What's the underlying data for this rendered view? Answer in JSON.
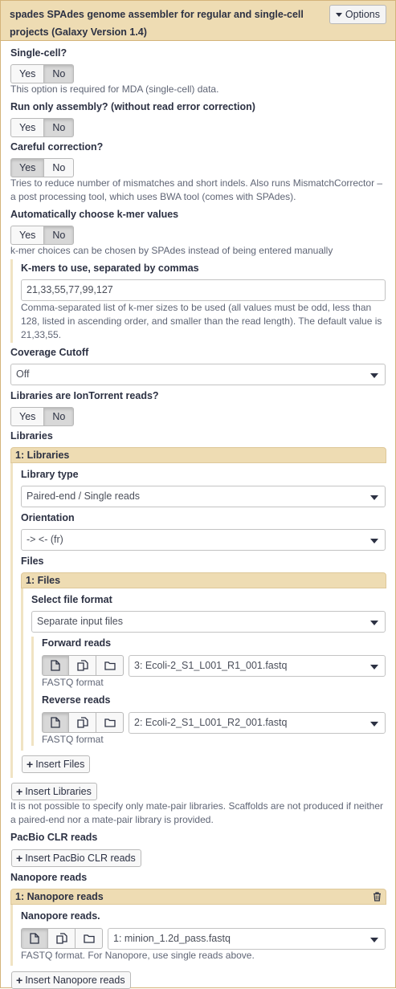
{
  "header": {
    "title": "spades SPAdes genome assembler for regular and single-cell projects (Galaxy Version 1.4)",
    "options_label": "Options"
  },
  "toggle_labels": {
    "yes": "Yes",
    "no": "No"
  },
  "single_cell": {
    "label": "Single-cell?",
    "selected": "No",
    "help": "This option is required for MDA (single-cell) data."
  },
  "only_assembly": {
    "label": "Run only assembly? (without read error correction)",
    "selected": "No"
  },
  "careful": {
    "label": "Careful correction?",
    "selected": "Yes",
    "help": "Tries to reduce number of mismatches and short indels. Also runs MismatchCorrector – a post processing tool, which uses BWA tool (comes with SPAdes)."
  },
  "auto_kmer": {
    "label": "Automatically choose k-mer values",
    "selected": "No",
    "help": "k-mer choices can be chosen by SPAdes instead of being entered manually"
  },
  "kmers": {
    "label": "K-mers to use, separated by commas",
    "value": "21,33,55,77,99,127",
    "help": "Comma-separated list of k-mer sizes to be used (all values must be odd, less than 128, listed in ascending order, and smaller than the read length). The default value is 21,33,55."
  },
  "coverage": {
    "label": "Coverage Cutoff",
    "value": "Off"
  },
  "iontorrent": {
    "label": "Libraries are IonTorrent reads?",
    "selected": "No"
  },
  "libraries": {
    "label": "Libraries",
    "repeat_title": "1: Libraries",
    "library_type_label": "Library type",
    "library_type_value": "Paired-end / Single reads",
    "orientation_label": "Orientation",
    "orientation_value": "-> <- (fr)",
    "files_label": "Files",
    "files_repeat_title": "1: Files",
    "file_format_label": "Select file format",
    "file_format_value": "Separate input files",
    "forward_label": "Forward reads",
    "forward_value": "3: Ecoli-2_S1_L001_R1_001.fastq",
    "forward_help": "FASTQ format",
    "reverse_label": "Reverse reads",
    "reverse_value": "2: Ecoli-2_S1_L001_R2_001.fastq",
    "reverse_help": "FASTQ format",
    "insert_files_label": "Insert Files",
    "insert_libraries_label": "Insert Libraries",
    "help": "It is not possible to specify only mate-pair libraries. Scaffolds are not produced if neither a paired-end nor a mate-pair library is provided."
  },
  "pacbio": {
    "label": "PacBio CLR reads",
    "insert_label": "Insert PacBio CLR reads"
  },
  "nanopore": {
    "label": "Nanopore reads",
    "repeat_title": "1: Nanopore reads",
    "field_label": "Nanopore reads.",
    "value": "1: minion_1.2d_pass.fastq",
    "help": "FASTQ format. For Nanopore, use single reads above.",
    "insert_label": "Insert Nanopore reads"
  }
}
